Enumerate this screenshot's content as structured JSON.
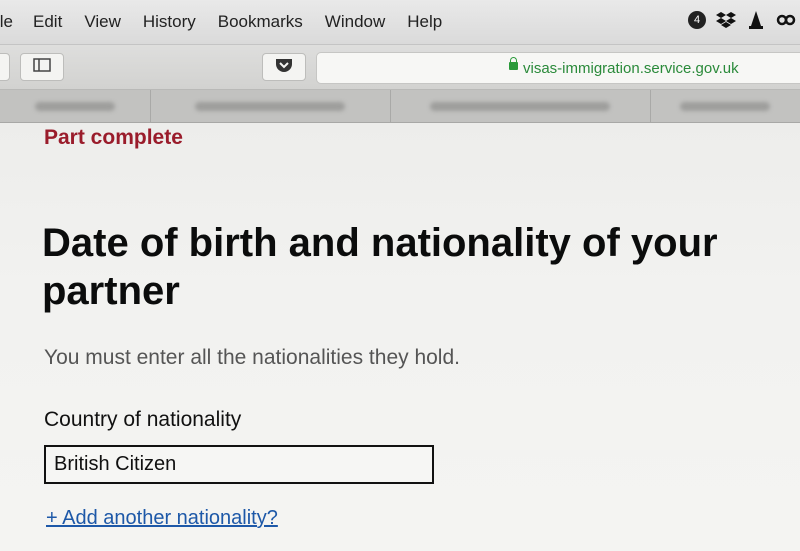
{
  "menubar": {
    "items": [
      "ile",
      "Edit",
      "View",
      "History",
      "Bookmarks",
      "Window",
      "Help"
    ],
    "tray": {
      "badge_count": "4",
      "icons": [
        "notification-badge-icon",
        "dropbox-icon",
        "vlc-cone-icon",
        "infinity-icon"
      ]
    }
  },
  "toolbar": {
    "url": "visas-immigration.service.gov.uk",
    "icons": [
      "sidebar-icon",
      "pocket-icon",
      "lock-icon"
    ]
  },
  "colors": {
    "accent_red": "#9a1c2b",
    "link_blue": "#1d58a8",
    "url_green": "#2a8a3a"
  },
  "page": {
    "status": "Part complete",
    "title": "Date of birth and nationality of your partner",
    "hint": "You must enter all the nationalities they hold.",
    "nationality_label": "Country of nationality",
    "nationality_value": "British Citizen",
    "add_link": "+ Add another nationality?"
  }
}
